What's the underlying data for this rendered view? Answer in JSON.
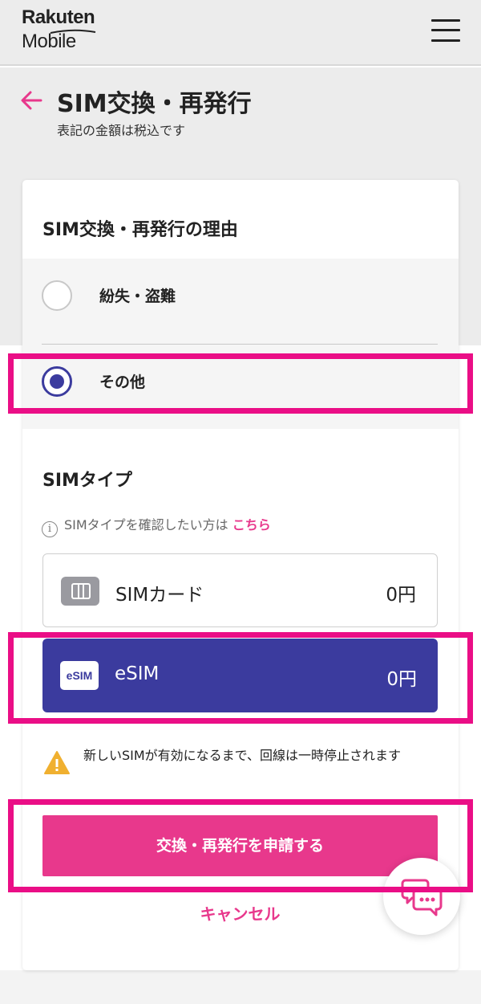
{
  "header": {
    "logo_top": "Rakuten",
    "logo_bottom": "Mobile",
    "menu_icon": "hamburger-menu-icon"
  },
  "page": {
    "title": "SIM交換・再発行",
    "subtitle": "表記の金額は税込です",
    "back_icon": "arrow-left-icon"
  },
  "reason_section": {
    "heading": "SIM交換・再発行の理由",
    "options": [
      {
        "label": "紛失・盗難",
        "selected": false
      },
      {
        "label": "その他",
        "selected": true
      }
    ]
  },
  "sim_section": {
    "heading": "SIMタイプ",
    "info_text": "SIMタイプを確認したい方は",
    "info_link": "こちら",
    "options": [
      {
        "name": "SIMカード",
        "price": "0円",
        "icon": "sim-card-icon",
        "selected": false
      },
      {
        "name": "eSIM",
        "price": "0円",
        "icon": "esim-icon",
        "icon_text": "eSIM",
        "selected": true
      }
    ]
  },
  "warning": {
    "text": "新しいSIMが有効になるまで、回線は一時停止されます",
    "icon": "warning-icon"
  },
  "actions": {
    "submit_label": "交換・再発行を申請する",
    "cancel_label": "キャンセル"
  },
  "chat": {
    "icon": "chat-bubble-icon"
  },
  "colors": {
    "accent": "#e8388c",
    "primary": "#3b3b9e",
    "highlight": "#ea0e86",
    "warning": "#f0b030"
  }
}
